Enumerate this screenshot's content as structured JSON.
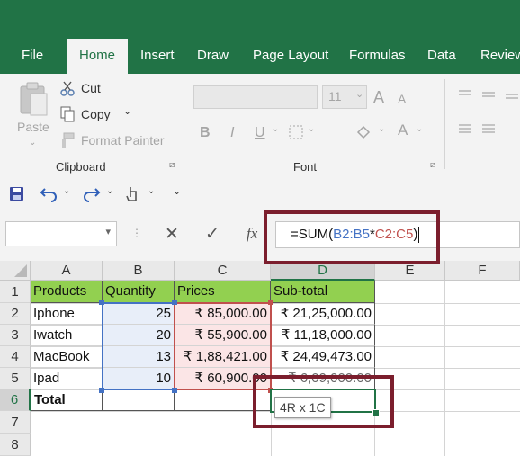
{
  "ribbon_tabs": [
    "File",
    "Home",
    "Insert",
    "Draw",
    "Page Layout",
    "Formulas",
    "Data",
    "Review"
  ],
  "clipboard": {
    "paste": "Paste",
    "cut": "Cut",
    "copy": "Copy",
    "format_painter": "Format Painter",
    "group_label": "Clipboard"
  },
  "font": {
    "size": "11",
    "bold": "B",
    "italic": "I",
    "underline": "U",
    "font_color": "A",
    "grow": "A",
    "shrink": "A",
    "group_label": "Font"
  },
  "formula_bar": {
    "cancel": "✕",
    "enter": "✓",
    "fx": "fx",
    "formula_prefix": "=SUM(",
    "ref1": "B2:B5",
    "op": "*",
    "ref2": "C2:C5",
    "suffix": ")"
  },
  "columns": [
    "A",
    "B",
    "C",
    "D",
    "E",
    "F"
  ],
  "rows": [
    "1",
    "2",
    "3",
    "4",
    "5",
    "6",
    "7",
    "8"
  ],
  "cells": {
    "A1": "Products",
    "B1": "Quantity",
    "C1": "Prices",
    "D1": "Sub-total",
    "A2": "Iphone",
    "B2": "25",
    "C2": "₹ 85,000.00",
    "D2": "₹ 21,25,000.00",
    "A3": "Iwatch",
    "B3": "20",
    "C3": "₹ 55,900.00",
    "D3": "₹ 11,18,000.00",
    "A4": "MacBook",
    "B4": "13",
    "C4": "₹ 1,88,421.00",
    "D4": "₹ 24,49,473.00",
    "A5": "Ipad",
    "B5": "10",
    "C5": "₹ 60,900.00",
    "D5": "₹ 6,09,000.00",
    "A6": "Total"
  },
  "tooltip": "4R x 1C",
  "colors": {
    "excel_green": "#217346",
    "header_fill": "#92d050",
    "ref_blue": "#4472c4",
    "ref_red": "#c0504d",
    "highlight_box": "#7b1e2d"
  }
}
